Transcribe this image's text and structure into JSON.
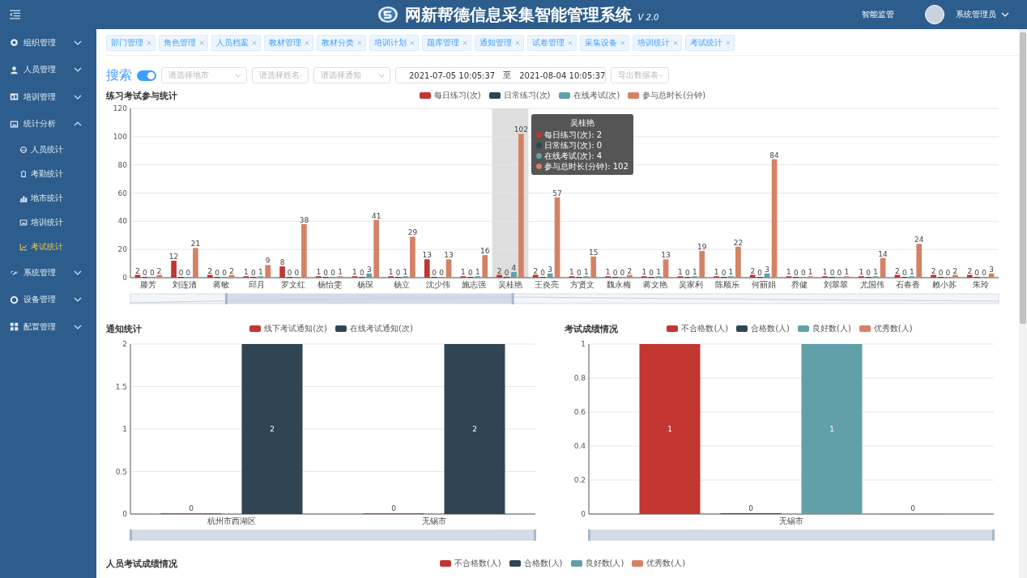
{
  "header": {
    "title": "网新帮德信息采集智能管理系统",
    "version": "V 2.0",
    "monitor_link": "智能监管",
    "user_name": "系统管理员"
  },
  "sidebar": [
    {
      "label": "组织管理",
      "expanded": false
    },
    {
      "label": "人员管理",
      "expanded": false
    },
    {
      "label": "培训管理",
      "expanded": false
    },
    {
      "label": "统计分析",
      "expanded": true,
      "children": [
        {
          "label": "人员统计",
          "selected": false
        },
        {
          "label": "考勤统计",
          "selected": false
        },
        {
          "label": "地市统计",
          "selected": false
        },
        {
          "label": "培训统计",
          "selected": false
        },
        {
          "label": "考试统计",
          "selected": true
        }
      ]
    },
    {
      "label": "系统管理",
      "expanded": false
    },
    {
      "label": "设备管理",
      "expanded": false
    },
    {
      "label": "配置管理",
      "expanded": false
    }
  ],
  "tabs": [
    {
      "label": "部门管理"
    },
    {
      "label": "角色管理"
    },
    {
      "label": "人员档案"
    },
    {
      "label": "教材管理"
    },
    {
      "label": "教材分类"
    },
    {
      "label": "培训计划"
    },
    {
      "label": "题库管理"
    },
    {
      "label": "通知管理"
    },
    {
      "label": "试卷管理"
    },
    {
      "label": "采集设备"
    },
    {
      "label": "培训统计"
    },
    {
      "label": "考试统计"
    }
  ],
  "filters": {
    "search_label": "搜索",
    "toggle_on": true,
    "city_placeholder": "请选择地市",
    "name_placeholder": "请选择姓名",
    "notice_placeholder": "请选择通知",
    "date_start": "2021-07-05 10:05:37",
    "date_separator": "至",
    "date_end": "2021-08-04 10:05:37",
    "export_placeholder": "导出数据表"
  },
  "sections": [
    {
      "title": "练习考试参与统计",
      "tooltip": {
        "title": "吴桂艳",
        "rows": [
          {
            "label": "每日练习(次): 2",
            "color": "#c23531"
          },
          {
            "label": "日常练习(次): 0",
            "color": "#2f4554"
          },
          {
            "label": "在线考试(次): 4",
            "color": "#61a0a8"
          },
          {
            "label": "参与总时长(分钟): 102",
            "color": "#d48265"
          }
        ]
      },
      "chart_data": {
        "type": "bar",
        "categories": [
          "滕芳",
          "刘连清",
          "蒋敏",
          "邱月",
          "罗文红",
          "杨怡雯",
          "杨琛",
          "杨立",
          "沈少伟",
          "施志强",
          "吴桂艳",
          "王炎亮",
          "方贤文",
          "魏永梅",
          "蒋文艳",
          "吴家利",
          "陈顺乐",
          "何丽娟",
          "乔健",
          "刘翠翠",
          "尤国伟",
          "石春香",
          "赖小苏",
          "朱玲"
        ],
        "series": [
          {
            "name": "每日练习(次)",
            "color": "#c23531",
            "values": [
              2,
              12,
              2,
              1,
              8,
              1,
              1,
              1,
              13,
              1,
              2,
              2,
              1,
              1,
              1,
              1,
              1,
              2,
              1,
              1,
              1,
              2,
              2,
              2
            ]
          },
          {
            "name": "日常练习(次)",
            "color": "#2f4554",
            "values": [
              0,
              0,
              0,
              0,
              0,
              0,
              0,
              0,
              0,
              0,
              0,
              0,
              0,
              0,
              0,
              0,
              0,
              0,
              0,
              0,
              0,
              0,
              0,
              0
            ]
          },
          {
            "name": "在线考试(次)",
            "color": "#61a0a8",
            "values": [
              0,
              0,
              0,
              1,
              0,
              0,
              3,
              1,
              0,
              1,
              4,
              3,
              1,
              0,
              1,
              1,
              1,
              3,
              0,
              0,
              1,
              1,
              0,
              0
            ]
          },
          {
            "name": "参与总时长(分钟)",
            "color": "#d48265",
            "values": [
              2,
              21,
              2,
              9,
              38,
              1,
              41,
              29,
              13,
              16,
              102,
              57,
              15,
              2,
              13,
              19,
              22,
              84,
              1,
              1,
              14,
              24,
              2,
              3
            ]
          }
        ],
        "yticks": [
          0,
          20,
          40,
          60,
          80,
          100,
          120
        ],
        "ylim": [
          0,
          120
        ],
        "grid": true,
        "bands": [
          {
            "axis": "x",
            "from": "吴桂艳",
            "to": "吴桂艳"
          }
        ],
        "data_labels": true
      }
    },
    {
      "title": "通知统计",
      "chart_data": {
        "type": "bar",
        "categories": [
          "杭州市西湖区",
          "无锡市"
        ],
        "series": [
          {
            "name": "线下考试通知(次)",
            "color": "#c23531",
            "values": [
              0,
              0
            ]
          },
          {
            "name": "在线考试通知(次)",
            "color": "#2f4554",
            "values": [
              2,
              2
            ]
          }
        ],
        "yticks": [
          0,
          0.5,
          1,
          1.5,
          2
        ],
        "ylim": [
          0,
          2
        ],
        "grid": true,
        "data_labels": true
      }
    },
    {
      "title": "考试成绩情况",
      "chart_data": {
        "type": "bar",
        "categories": [
          "无锡市"
        ],
        "series": [
          {
            "name": "不合格数(人)",
            "color": "#c23531",
            "values": [
              1
            ]
          },
          {
            "name": "合格数(人)",
            "color": "#2f4554",
            "values": [
              0
            ]
          },
          {
            "name": "良好数(人)",
            "color": "#61a0a8",
            "values": [
              1
            ]
          },
          {
            "name": "优秀数(人)",
            "color": "#d48265",
            "values": [
              0
            ]
          }
        ],
        "yticks": [
          0,
          0.2,
          0.4,
          0.6,
          0.8,
          1
        ],
        "ylim": [
          0,
          1
        ],
        "grid": true,
        "data_labels": true
      }
    },
    {
      "title": "人员考试成绩情况",
      "legend": [
        {
          "name": "不合格数(人)",
          "color": "#c23531"
        },
        {
          "name": "合格数(人)",
          "color": "#2f4554"
        },
        {
          "name": "良好数(人)",
          "color": "#61a0a8"
        },
        {
          "name": "优秀数(人)",
          "color": "#d48265"
        }
      ]
    }
  ]
}
